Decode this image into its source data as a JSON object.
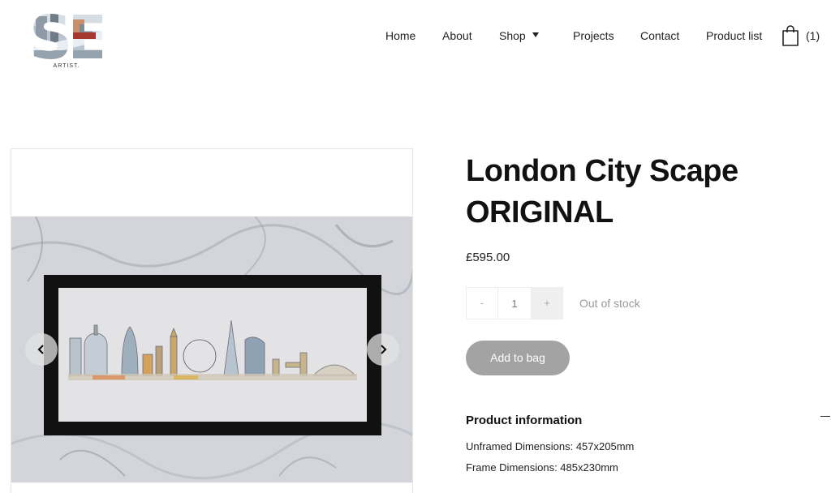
{
  "header": {
    "logo_text": "SE",
    "logo_caption": "ARTIST.",
    "nav": [
      {
        "label": "Home"
      },
      {
        "label": "About"
      },
      {
        "label": "Shop"
      },
      {
        "label": "Projects"
      },
      {
        "label": "Contact"
      },
      {
        "label": "Product list"
      }
    ],
    "cart_count": "(1)"
  },
  "product": {
    "title": "London City Scape ORIGINAL",
    "price": "£595.00",
    "quantity": {
      "minus": "-",
      "value": "1",
      "plus": "+"
    },
    "stock_status": "Out of stock",
    "add_to_bag": "Add to bag",
    "info": {
      "title": "Product information",
      "lines": [
        "Unframed Dimensions: 457x205mm",
        "Frame Dimensions: 485x230mm"
      ]
    }
  },
  "icons": {
    "cart": "shopping-bag-icon",
    "dropdown": "chevron-down-icon",
    "prev": "chevron-left-icon",
    "next": "chevron-right-icon",
    "collapse": "minus-icon"
  },
  "colors": {
    "button_bg": "#a3a3a3",
    "stock_text": "#9a9a9a",
    "frame": "#111111"
  }
}
